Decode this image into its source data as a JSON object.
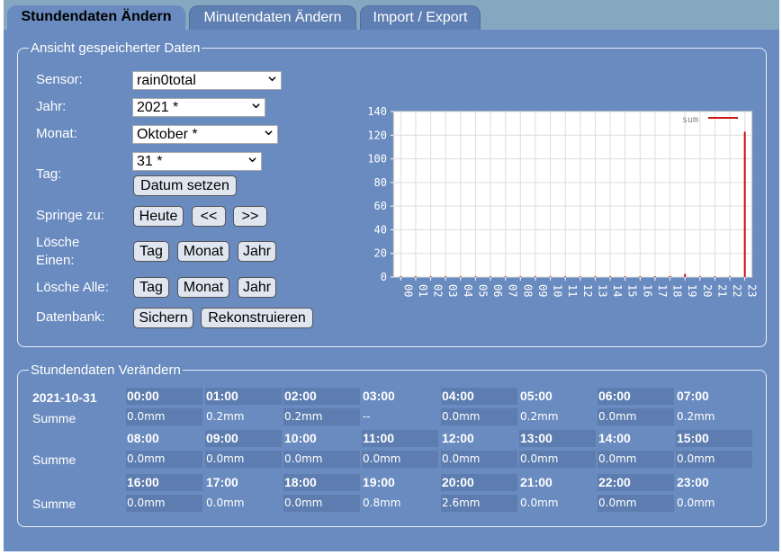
{
  "tabs": [
    {
      "label": "Stundendaten Ändern"
    },
    {
      "label": "Minutendaten Ändern"
    },
    {
      "label": "Import / Export"
    }
  ],
  "view": {
    "legend": "Ansicht gespeicherter Daten",
    "sensor": {
      "label": "Sensor:",
      "value": "rain0total"
    },
    "year": {
      "label": "Jahr:",
      "value": "2021 *"
    },
    "month": {
      "label": "Monat:",
      "value": "Oktober *"
    },
    "day": {
      "label": "Tag:",
      "value": "31 *"
    },
    "set_date_button": "Datum setzen",
    "jump": {
      "label": "Springe zu:",
      "today": "Heute",
      "prev": "<<",
      "next": ">>"
    },
    "delete_one": {
      "label_line1": "Lösche",
      "label_line2": "Einen:",
      "day": "Tag",
      "month": "Monat",
      "year": "Jahr"
    },
    "delete_all": {
      "label": "Lösche Alle:",
      "day": "Tag",
      "month": "Monat",
      "year": "Jahr"
    },
    "database": {
      "label": "Datenbank:",
      "backup": "Sichern",
      "rebuild": "Rekonstruieren"
    }
  },
  "chart_data": {
    "type": "bar",
    "categories": [
      "00",
      "01",
      "02",
      "03",
      "04",
      "05",
      "06",
      "07",
      "08",
      "09",
      "10",
      "11",
      "12",
      "13",
      "14",
      "15",
      "16",
      "17",
      "18",
      "19",
      "20",
      "21",
      "22",
      "23"
    ],
    "series": [
      {
        "name": "sum",
        "values": [
          0,
          0,
          0,
          0,
          0,
          0,
          0,
          0,
          0,
          0,
          0,
          0,
          0,
          0,
          0,
          0,
          0,
          0,
          0.8,
          2.6,
          0,
          0,
          0,
          123
        ]
      }
    ],
    "ylim": [
      0,
      140
    ],
    "yticks": [
      0,
      20,
      40,
      60,
      80,
      100,
      120,
      140
    ],
    "grid": true,
    "legend_position": "top-right",
    "colors": {
      "series": "#cc1111",
      "grid": "#dddddd",
      "background": "#ffffff",
      "axis_text": "#ffffff"
    }
  },
  "hourly": {
    "legend": "Stundendaten Verändern",
    "date": "2021-10-31",
    "row_label": "Summe",
    "rows": [
      {
        "hours": [
          "00:00",
          "01:00",
          "02:00",
          "03:00",
          "04:00",
          "05:00",
          "06:00",
          "07:00"
        ],
        "values": [
          "0.0mm",
          "0.2mm",
          "0.2mm",
          "--",
          "0.0mm",
          "0.2mm",
          "0.0mm",
          "0.2mm"
        ]
      },
      {
        "hours": [
          "08:00",
          "09:00",
          "10:00",
          "11:00",
          "12:00",
          "13:00",
          "14:00",
          "15:00"
        ],
        "values": [
          "0.0mm",
          "0.0mm",
          "0.0mm",
          "0.0mm",
          "0.0mm",
          "0.0mm",
          "0.0mm",
          "0.0mm"
        ]
      },
      {
        "hours": [
          "16:00",
          "17:00",
          "18:00",
          "19:00",
          "20:00",
          "21:00",
          "22:00",
          "23:00"
        ],
        "values": [
          "0.0mm",
          "0.0mm",
          "0.0mm",
          "0.8mm",
          "2.6mm",
          "0.0mm",
          "0.0mm",
          "0.0mm"
        ]
      }
    ]
  },
  "colors": {
    "frame": "#6a8bbf",
    "tabbar": "#86a7c0",
    "cell": "#5d7db0"
  }
}
